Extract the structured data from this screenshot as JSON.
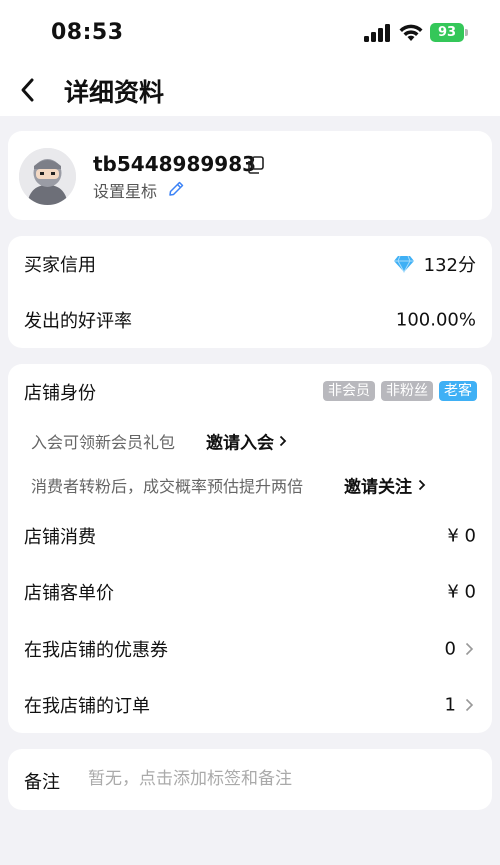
{
  "status_bar": {
    "time": "08:53",
    "battery": "93",
    "icons": [
      "signal-icon",
      "wifi-icon",
      "battery-icon"
    ]
  },
  "header": {
    "title": "详细资料",
    "back_icon": "chevron-left-icon"
  },
  "profile": {
    "username": "tb5448989983",
    "set_star_label": "设置星标",
    "icons": [
      "avatar",
      "copy-icon",
      "edit-icon"
    ]
  },
  "credit": {
    "buyer_credit_label": "买家信用",
    "buyer_credit_value": "132分",
    "positive_rate_label": "发出的好评率",
    "positive_rate_value": "100.00%",
    "diamond_icon": "diamond-icon"
  },
  "store": {
    "identity_label": "店铺身份",
    "tags": [
      "非会员",
      "非粉丝",
      "老客"
    ],
    "membership_desc": "入会可领新会员礼包",
    "membership_action": "邀请入会",
    "follow_desc": "消费者转粉后，成交概率预估提升两倍",
    "follow_action": "邀请关注",
    "spend_label": "店铺消费",
    "spend_value": "¥ 0",
    "avg_order_label": "店铺客单价",
    "avg_order_value": "¥ 0",
    "coupons_label": "在我店铺的优惠券",
    "coupons_value": "0",
    "orders_label": "在我店铺的订单",
    "orders_value": "1"
  },
  "note": {
    "label": "备注",
    "placeholder": "暂无，点击添加标签和备注"
  },
  "colors": {
    "page_bg": "#f2f2f6",
    "card_bg": "#ffffff",
    "tag_gray": "#b8b8bd",
    "tag_blue": "#3fb0f5",
    "battery_green": "#34c759",
    "diamond_blue": "#3fb0f5"
  }
}
